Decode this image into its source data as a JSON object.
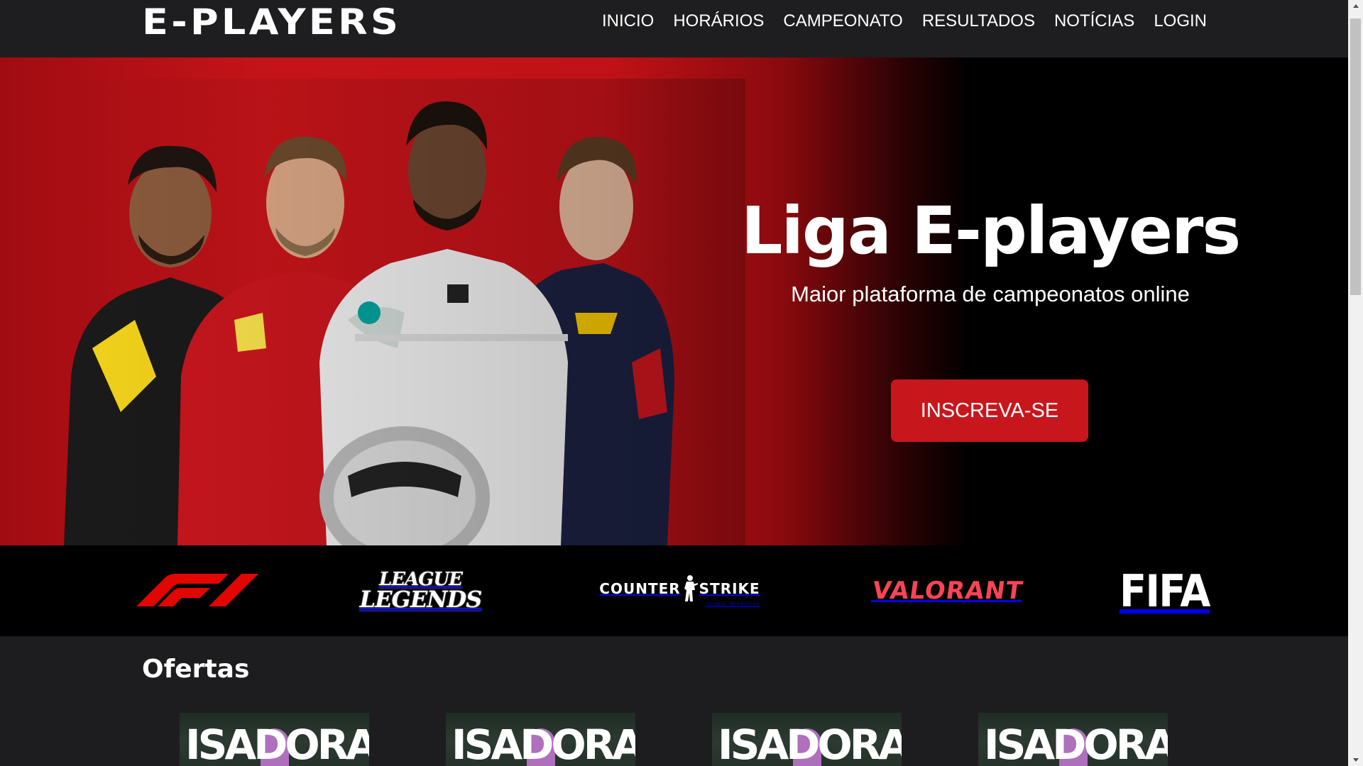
{
  "header": {
    "logo": "E-PLAYERS",
    "nav": [
      "INICIO",
      "HORÁRIOS",
      "CAMPEONATO",
      "RESULTADOS",
      "NOTÍCIAS",
      "LOGIN"
    ]
  },
  "hero": {
    "title": "Liga E-players",
    "subtitle": "Maior plataforma de campeonatos online",
    "cta_label": "INSCREVA-SE"
  },
  "games": {
    "f1": "F1",
    "lol_line1": "LEAGUE",
    "lol_line2": "LEGENDS",
    "cs_main_left": "COUNTER",
    "cs_main_right": "STRIKE",
    "cs_sub": "GLOBAL OFFENSIVE",
    "valorant": "VALORANT",
    "fifa": "FIFA"
  },
  "offers": {
    "title": "Ofertas",
    "items": [
      {
        "name": "ISADORA"
      },
      {
        "name": "ISADORA"
      },
      {
        "name": "ISADORA"
      },
      {
        "name": "ISADORA"
      }
    ]
  },
  "colors": {
    "accent": "#c8161d",
    "header_bg": "#1e1e20",
    "page_bg": "#1d1d1f",
    "valorant_red": "#fa4454"
  }
}
